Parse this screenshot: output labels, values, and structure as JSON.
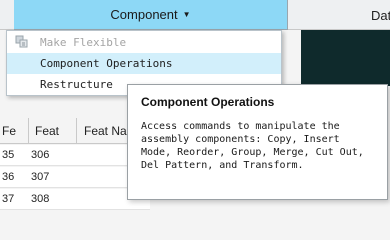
{
  "header": {
    "tab_label": "Component",
    "right_label": "Dat"
  },
  "grid": {
    "columns": [
      "Fe",
      "Feat",
      "Feat Na"
    ],
    "rows": [
      [
        "35",
        "306"
      ],
      [
        "36",
        "307"
      ],
      [
        "37",
        "308"
      ]
    ]
  },
  "menu": {
    "items": [
      {
        "label": "Make Flexible",
        "disabled": true
      },
      {
        "label": "Component Operations",
        "hovered": true
      },
      {
        "label": "Restructure"
      }
    ]
  },
  "tooltip": {
    "title": "Component Operations",
    "description": "Access commands to manipulate the assembly components: Copy, Insert Mode, Reorder, Group, Merge, Cut Out, Del Pattern, and Transform."
  },
  "colors": {
    "header_accent": "#8dd8f6",
    "hover": "#d2effb",
    "dark_panel": "#0f2a2c"
  },
  "icons": {
    "make_flexible": "make-flexible-icon",
    "caret": "chevron-down-icon"
  }
}
